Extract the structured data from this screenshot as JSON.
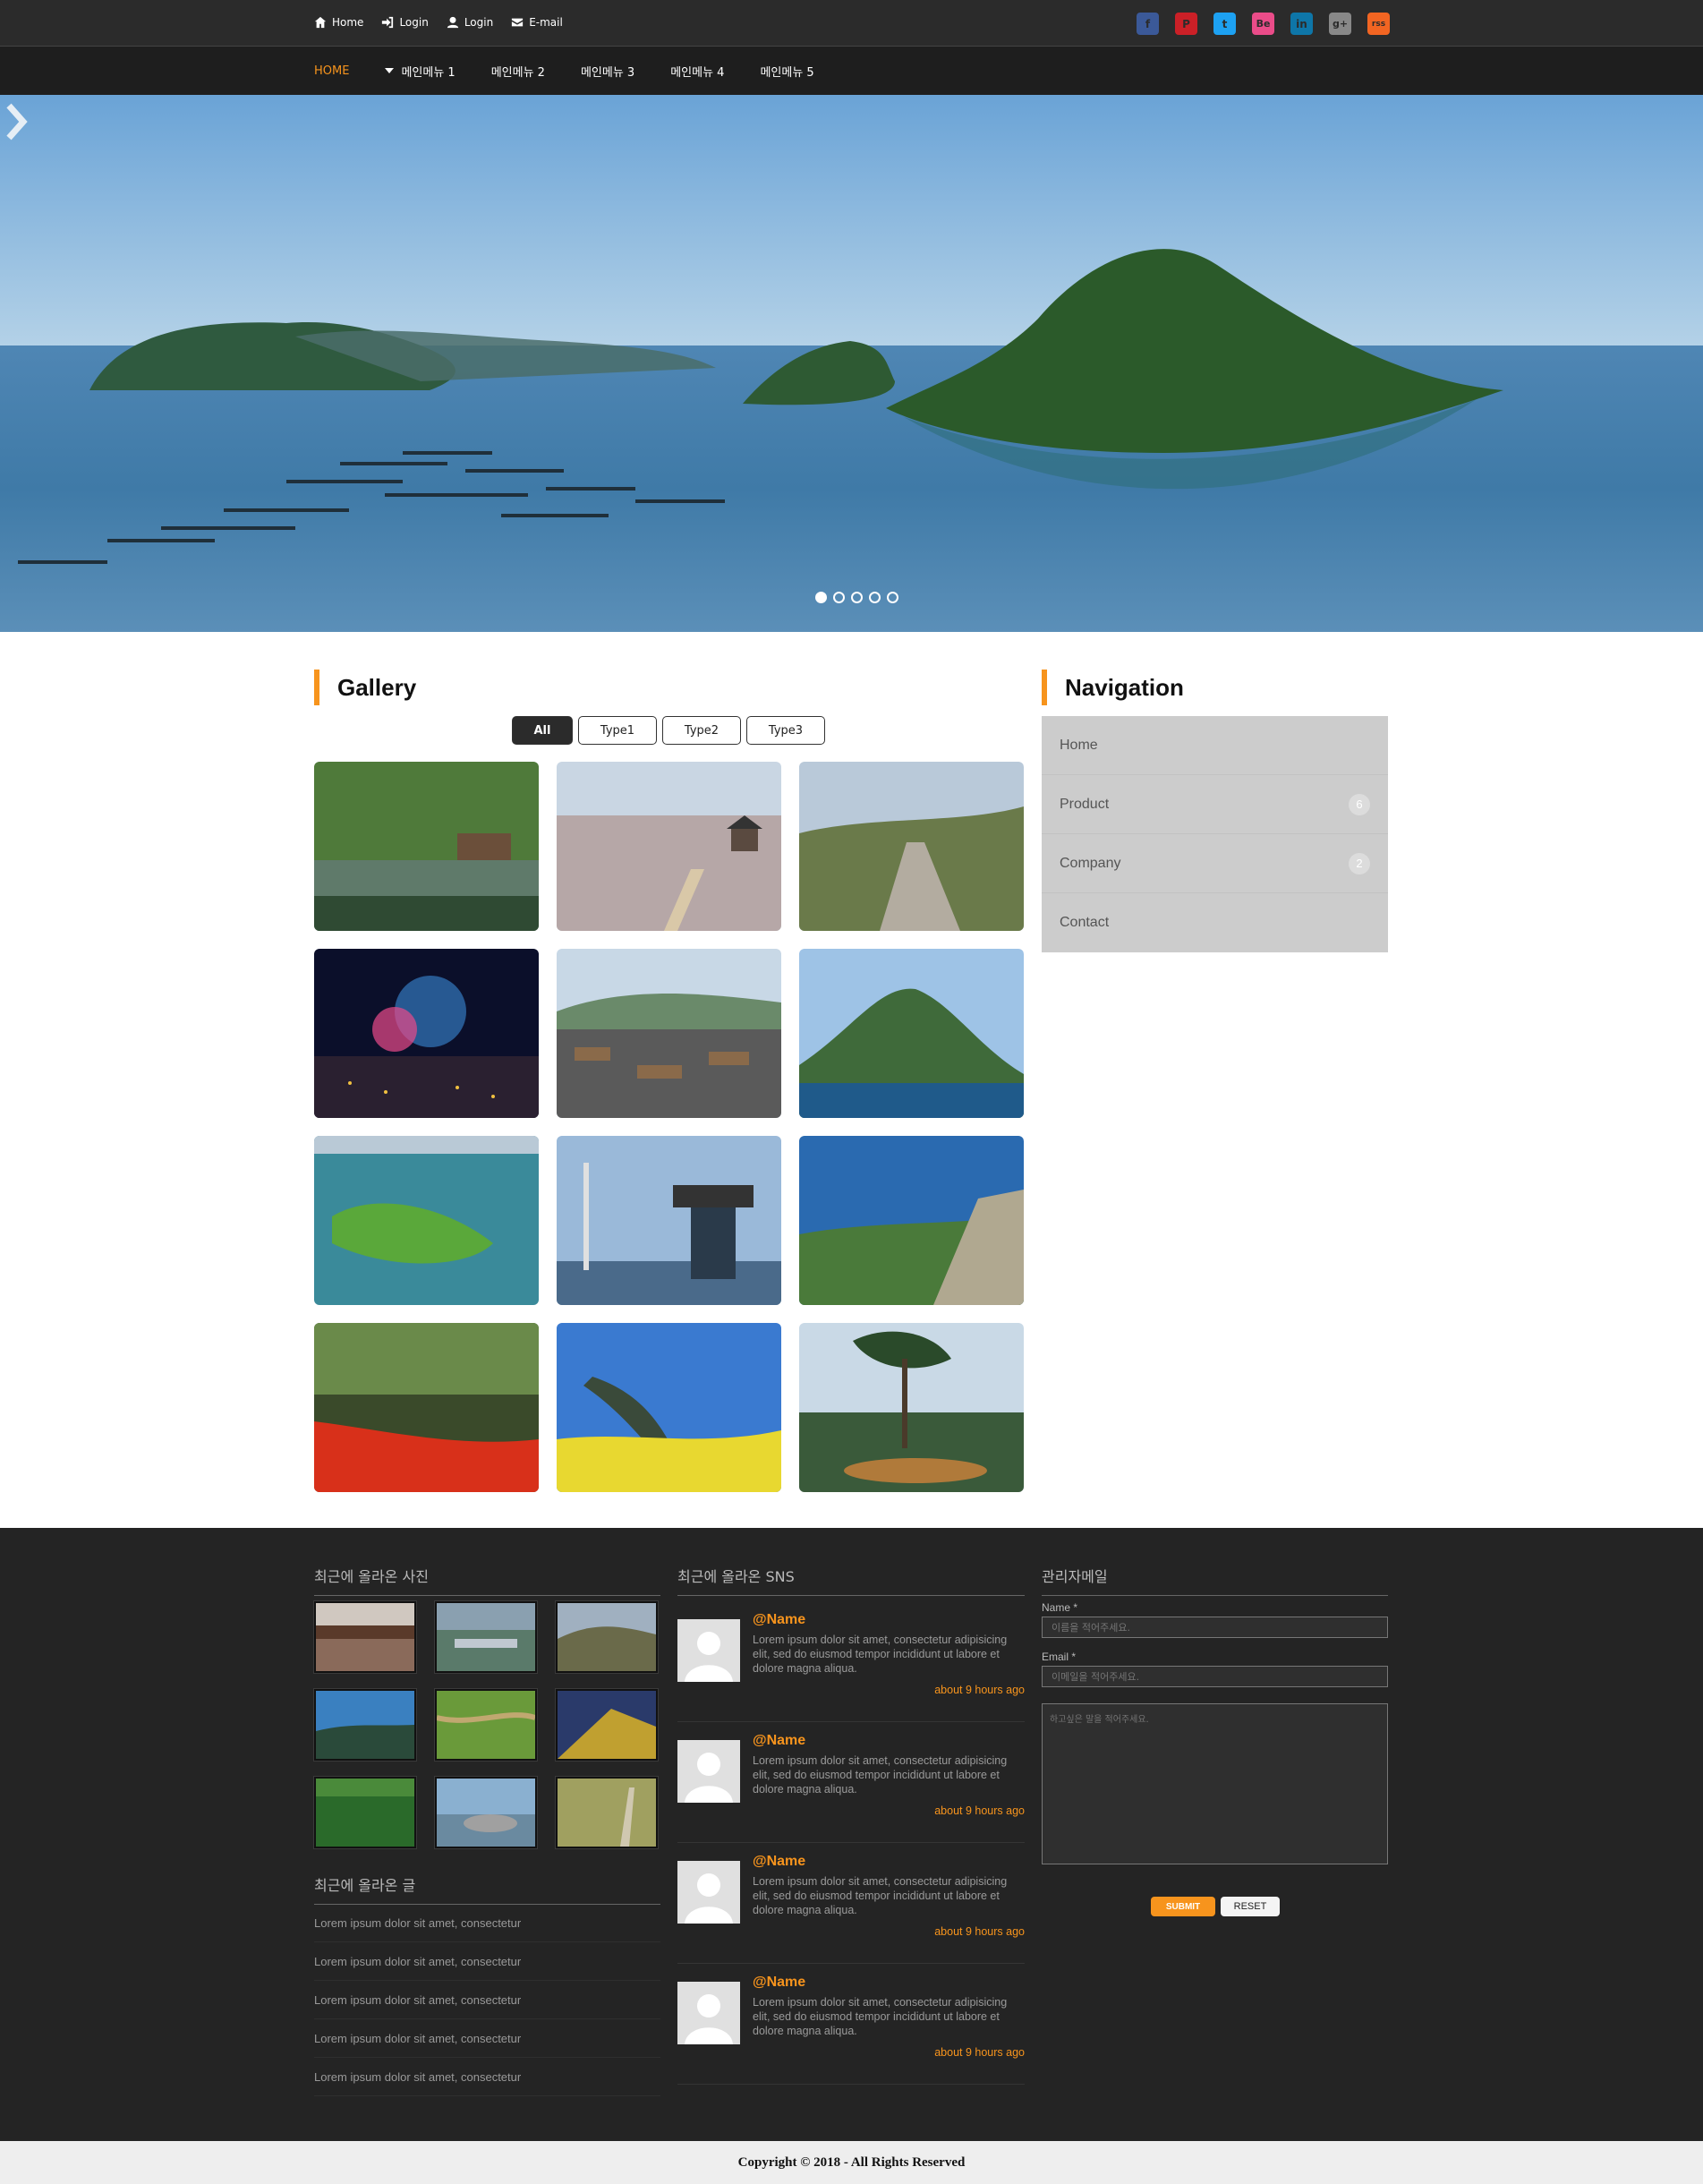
{
  "topbar": {
    "links": [
      {
        "label": "Home",
        "icon": "home-icon"
      },
      {
        "label": "Login",
        "icon": "sign-in-icon"
      },
      {
        "label": "Login",
        "icon": "user-icon"
      },
      {
        "label": "E-mail",
        "icon": "envelope-icon"
      }
    ],
    "social": [
      {
        "name": "facebook-icon",
        "glyph": "f",
        "color": "#3b5998"
      },
      {
        "name": "pinterest-icon",
        "glyph": "P",
        "color": "#cb2027"
      },
      {
        "name": "twitter-icon",
        "glyph": "t",
        "color": "#1da1f2"
      },
      {
        "name": "behance-icon",
        "glyph": "Be",
        "color": "#ea4c89"
      },
      {
        "name": "linkedin-icon",
        "glyph": "in",
        "color": "#0e76a8"
      },
      {
        "name": "google-plus-icon",
        "glyph": "g+",
        "color": "#888888"
      },
      {
        "name": "rss-icon",
        "glyph": "rss",
        "color": "#f26522"
      }
    ]
  },
  "menu": {
    "items": [
      "HOME",
      "메인메뉴 1",
      "메인메뉴 2",
      "메인메뉴 3",
      "메인메뉴 4",
      "메인메뉴 5"
    ],
    "active_color": "#f7941d"
  },
  "hero": {
    "slide_count": 5,
    "active_slide": 1
  },
  "gallery": {
    "title": "Gallery",
    "filters": [
      "All",
      "Type1",
      "Type2",
      "Type3"
    ],
    "active_filter": "All",
    "images": [
      "garden-pond-pavilion",
      "cherry-blossom-pavilion",
      "stone-path-hill",
      "night-fireworks-city",
      "village-rooftops",
      "rocky-island-cliff",
      "aerial-green-island",
      "bridge-observation-tower",
      "mountain-rock-sky",
      "red-flower-forest",
      "yellow-flowers-causeway",
      "tree-and-statue-garden"
    ]
  },
  "navigation": {
    "title": "Navigation",
    "items": [
      {
        "label": "Home",
        "count": ""
      },
      {
        "label": "Product",
        "count": "6"
      },
      {
        "label": "Company",
        "count": "2"
      },
      {
        "label": "Contact",
        "count": ""
      }
    ]
  },
  "footer": {
    "photos_title": "최근에 올라온 사진",
    "posts_title": "최근에 올라온 글",
    "posts": [
      "Lorem ipsum dolor sit amet, consectetur",
      "Lorem ipsum dolor sit amet, consectetur",
      "Lorem ipsum dolor sit amet, consectetur",
      "Lorem ipsum dolor sit amet, consectetur",
      "Lorem ipsum dolor sit amet, consectetur"
    ],
    "sns_title": "최근에 올라온 SNS",
    "sns": [
      {
        "name": "@Name",
        "text": "Lorem ipsum dolor sit amet, consectetur adipisicing elit, sed do eiusmod tempor incididunt ut labore et dolore magna aliqua.",
        "time": "about 9 hours ago"
      },
      {
        "name": "@Name",
        "text": "Lorem ipsum dolor sit amet, consectetur adipisicing elit, sed do eiusmod tempor incididunt ut labore et dolore magna aliqua.",
        "time": "about 9 hours ago"
      },
      {
        "name": "@Name",
        "text": "Lorem ipsum dolor sit amet, consectetur adipisicing elit, sed do eiusmod tempor incididunt ut labore et dolore magna aliqua.",
        "time": "about 9 hours ago"
      },
      {
        "name": "@Name",
        "text": "Lorem ipsum dolor sit amet, consectetur adipisicing elit, sed do eiusmod tempor incididunt ut labore et dolore magna aliqua.",
        "time": "about 9 hours ago"
      }
    ],
    "mail": {
      "title": "관리자메일",
      "name_label": "Name *",
      "name_placeholder": "이름을 적어주세요.",
      "email_label": "Email *",
      "email_placeholder": "이메일을 적어주세요.",
      "message_placeholder": "하고싶은 말을 적어주세요.",
      "submit_label": "SUBMIT",
      "reset_label": "RESET"
    }
  },
  "copyright": "Copyright © 2018 - All Rights Reserved",
  "colors": {
    "accent": "#f7941d",
    "dark": "#2b2b2b",
    "footer": "#242424"
  }
}
